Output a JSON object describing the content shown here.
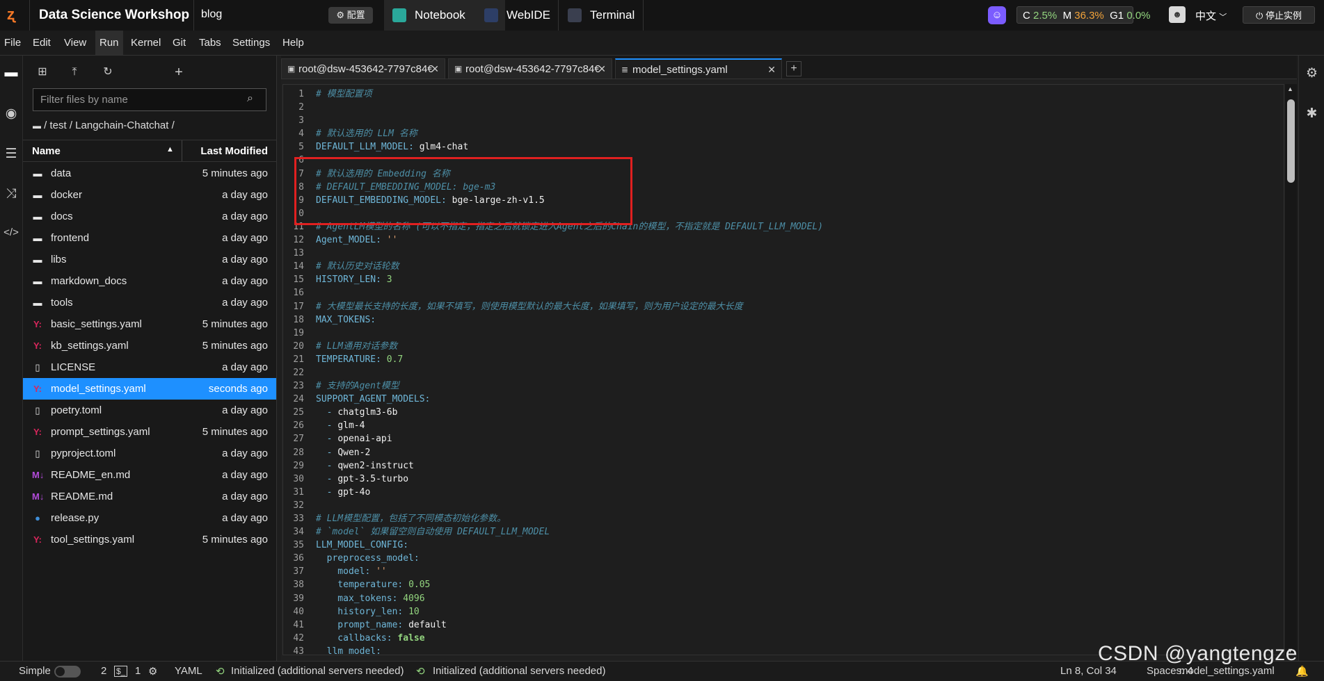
{
  "topbar": {
    "app_title": "Data Science Workshop",
    "project": "blog",
    "config_button": "配置",
    "tabs": [
      {
        "label": "Notebook",
        "active": true
      },
      {
        "label": "WebIDE",
        "active": false
      },
      {
        "label": "Terminal",
        "active": false
      }
    ],
    "resources": {
      "c_label": "C",
      "c_value": "2.5%",
      "m_label": "M",
      "m_value": "36.3%",
      "g_label": "G1",
      "g_value": "0.0%"
    },
    "language": "中文",
    "stop_button": "停止实例"
  },
  "menu": [
    "File",
    "Edit",
    "View",
    "Run",
    "Kernel",
    "Git",
    "Tabs",
    "Settings",
    "Help"
  ],
  "file_browser": {
    "filter_placeholder": "Filter files by name",
    "breadcrumb": "/ test / Langchain-Chatchat /",
    "col_name": "Name",
    "col_modified": "Last Modified",
    "files": [
      {
        "name": "data",
        "type": "folder",
        "modified": "5 minutes ago"
      },
      {
        "name": "docker",
        "type": "folder",
        "modified": "a day ago"
      },
      {
        "name": "docs",
        "type": "folder",
        "modified": "a day ago"
      },
      {
        "name": "frontend",
        "type": "folder",
        "modified": "a day ago"
      },
      {
        "name": "libs",
        "type": "folder",
        "modified": "a day ago"
      },
      {
        "name": "markdown_docs",
        "type": "folder",
        "modified": "a day ago"
      },
      {
        "name": "tools",
        "type": "folder",
        "modified": "a day ago"
      },
      {
        "name": "basic_settings.yaml",
        "type": "yaml",
        "modified": "5 minutes ago"
      },
      {
        "name": "kb_settings.yaml",
        "type": "yaml",
        "modified": "5 minutes ago"
      },
      {
        "name": "LICENSE",
        "type": "file",
        "modified": "a day ago"
      },
      {
        "name": "model_settings.yaml",
        "type": "yaml",
        "modified": "seconds ago",
        "selected": true
      },
      {
        "name": "poetry.toml",
        "type": "file",
        "modified": "a day ago"
      },
      {
        "name": "prompt_settings.yaml",
        "type": "yaml",
        "modified": "5 minutes ago"
      },
      {
        "name": "pyproject.toml",
        "type": "file",
        "modified": "a day ago"
      },
      {
        "name": "README_en.md",
        "type": "md",
        "modified": "a day ago"
      },
      {
        "name": "README.md",
        "type": "md",
        "modified": "a day ago"
      },
      {
        "name": "release.py",
        "type": "py",
        "modified": "a day ago"
      },
      {
        "name": "tool_settings.yaml",
        "type": "yaml",
        "modified": "5 minutes ago"
      }
    ]
  },
  "editor_tabs": [
    {
      "label": "root@dsw-453642-7797c84€",
      "type": "terminal"
    },
    {
      "label": "root@dsw-453642-7797c84€",
      "type": "terminal"
    },
    {
      "label": "model_settings.yaml",
      "type": "file",
      "active": true
    }
  ],
  "code_lines": [
    [
      [
        "c-com",
        "# 模型配置项"
      ]
    ],
    [],
    [],
    [
      [
        "c-com",
        "# 默认选用的 LLM 名称"
      ]
    ],
    [
      [
        "c-key",
        "DEFAULT_LLM_MODEL"
      ],
      [
        "c-key",
        ": "
      ],
      [
        "c-val",
        "glm4-chat"
      ]
    ],
    [],
    [
      [
        "c-com",
        "# 默认选用的 Embedding 名称"
      ]
    ],
    [
      [
        "c-com",
        "# DEFAULT_EMBEDDING_MODEL: bge-m3"
      ]
    ],
    [
      [
        "c-key",
        "DEFAULT_EMBEDDING_MODEL"
      ],
      [
        "c-key",
        ": "
      ],
      [
        "c-val",
        "bge-large-zh-v1.5"
      ]
    ],
    [],
    [
      [
        "c-com",
        "# AgentLM模型的名称 (可以不指定，指定之后就锁定进入Agent之后的Chain的模型，不指定就是 DEFAULT_LLM_MODEL)"
      ]
    ],
    [
      [
        "c-key",
        "Agent_MODEL"
      ],
      [
        "c-key",
        ": "
      ],
      [
        "c-str",
        "''"
      ]
    ],
    [],
    [
      [
        "c-com",
        "# 默认历史对话轮数"
      ]
    ],
    [
      [
        "c-key",
        "HISTORY_LEN"
      ],
      [
        "c-key",
        ": "
      ],
      [
        "c-num",
        "3"
      ]
    ],
    [],
    [
      [
        "c-com",
        "# 大模型最长支持的长度，如果不填写，则使用模型默认的最大长度，如果填写，则为用户设定的最大长度"
      ]
    ],
    [
      [
        "c-key",
        "MAX_TOKENS"
      ],
      [
        "c-key",
        ":"
      ]
    ],
    [],
    [
      [
        "c-com",
        "# LLM通用对话参数"
      ]
    ],
    [
      [
        "c-key",
        "TEMPERATURE"
      ],
      [
        "c-key",
        ": "
      ],
      [
        "c-num",
        "0.7"
      ]
    ],
    [],
    [
      [
        "c-com",
        "# 支持的Agent模型"
      ]
    ],
    [
      [
        "c-key",
        "SUPPORT_AGENT_MODELS"
      ],
      [
        "c-key",
        ":"
      ]
    ],
    [
      [
        "c-dash",
        "  - "
      ],
      [
        "c-val",
        "chatglm3-6b"
      ]
    ],
    [
      [
        "c-dash",
        "  - "
      ],
      [
        "c-val",
        "glm-4"
      ]
    ],
    [
      [
        "c-dash",
        "  - "
      ],
      [
        "c-val",
        "openai-api"
      ]
    ],
    [
      [
        "c-dash",
        "  - "
      ],
      [
        "c-val",
        "Qwen-2"
      ]
    ],
    [
      [
        "c-dash",
        "  - "
      ],
      [
        "c-val",
        "qwen2-instruct"
      ]
    ],
    [
      [
        "c-dash",
        "  - "
      ],
      [
        "c-val",
        "gpt-3.5-turbo"
      ]
    ],
    [
      [
        "c-dash",
        "  - "
      ],
      [
        "c-val",
        "gpt-4o"
      ]
    ],
    [],
    [
      [
        "c-com",
        "# LLM模型配置，包括了不同模态初始化参数。"
      ]
    ],
    [
      [
        "c-com",
        "# `model` 如果留空则自动使用 DEFAULT_LLM_MODEL"
      ]
    ],
    [
      [
        "c-key",
        "LLM_MODEL_CONFIG"
      ],
      [
        "c-key",
        ":"
      ]
    ],
    [
      [
        "c-key",
        "  preprocess_model"
      ],
      [
        "c-key",
        ":"
      ]
    ],
    [
      [
        "c-key",
        "    model"
      ],
      [
        "c-key",
        ": "
      ],
      [
        "c-str",
        "''"
      ]
    ],
    [
      [
        "c-key",
        "    temperature"
      ],
      [
        "c-key",
        ": "
      ],
      [
        "c-num",
        "0.05"
      ]
    ],
    [
      [
        "c-key",
        "    max_tokens"
      ],
      [
        "c-key",
        ": "
      ],
      [
        "c-num",
        "4096"
      ]
    ],
    [
      [
        "c-key",
        "    history_len"
      ],
      [
        "c-key",
        ": "
      ],
      [
        "c-num",
        "10"
      ]
    ],
    [
      [
        "c-key",
        "    prompt_name"
      ],
      [
        "c-key",
        ": "
      ],
      [
        "c-val",
        "default"
      ]
    ],
    [
      [
        "c-key",
        "    callbacks"
      ],
      [
        "c-key",
        ": "
      ],
      [
        "c-bool",
        "false"
      ]
    ],
    [
      [
        "c-key",
        "  llm_model"
      ],
      [
        "c-key",
        ":"
      ]
    ]
  ],
  "line_numbers": [
    "1",
    "2",
    "3",
    "4",
    "5",
    "6",
    "7",
    "8",
    "9",
    "0",
    "11",
    "12",
    "13",
    "14",
    "15",
    "16",
    "17",
    "18",
    "19",
    "20",
    "21",
    "22",
    "23",
    "24",
    "25",
    "26",
    "27",
    "28",
    "29",
    "30",
    "31",
    "32",
    "33",
    "34",
    "35",
    "36",
    "37",
    "38",
    "39",
    "40",
    "41",
    "42",
    "43"
  ],
  "statusbar": {
    "mode": "Simple",
    "count1": "2",
    "count2": "1",
    "filetype": "YAML",
    "lsp1": "Initialized (additional servers needed)",
    "lsp2": "Initialized (additional servers needed)",
    "cursor": "Ln 8, Col 34",
    "spaces": "Spaces: 4",
    "filename": "model_settings.yaml"
  },
  "watermark": "CSDN @yangtengze"
}
